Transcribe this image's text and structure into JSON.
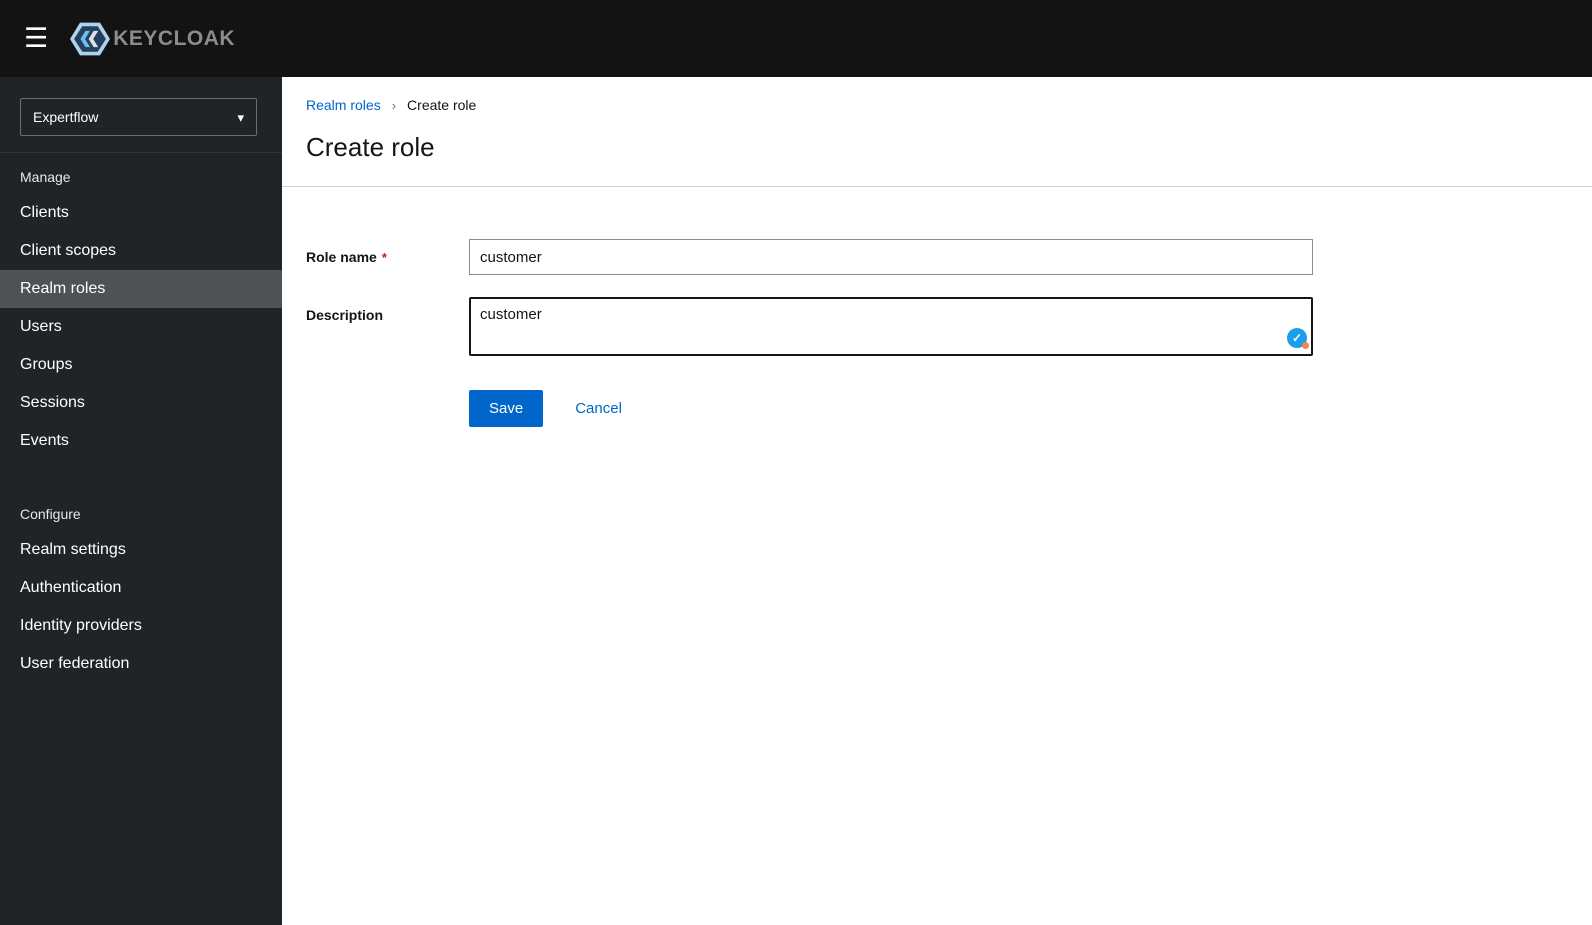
{
  "header": {
    "brand": "KEYCLOAK"
  },
  "icons": {
    "hamburger": "☰",
    "caret_down": "▾",
    "check": "✓"
  },
  "sidebar": {
    "realm_selector": {
      "value": "Expertflow"
    },
    "sections": [
      {
        "label": "Manage",
        "items": [
          {
            "label": "Clients"
          },
          {
            "label": "Client scopes"
          },
          {
            "label": "Realm roles",
            "active": true
          },
          {
            "label": "Users"
          },
          {
            "label": "Groups"
          },
          {
            "label": "Sessions"
          },
          {
            "label": "Events"
          }
        ]
      },
      {
        "label": "Configure",
        "items": [
          {
            "label": "Realm settings"
          },
          {
            "label": "Authentication"
          },
          {
            "label": "Identity providers"
          },
          {
            "label": "User federation"
          }
        ]
      }
    ]
  },
  "breadcrumb": {
    "separator": "›",
    "items": [
      {
        "label": "Realm roles"
      },
      {
        "label": "Create role"
      }
    ]
  },
  "page": {
    "title": "Create role"
  },
  "form": {
    "role_name": {
      "label": "Role name",
      "required_marker": "*",
      "value": "customer"
    },
    "description": {
      "label": "Description",
      "value": "customer"
    },
    "actions": {
      "save_label": "Save",
      "cancel_label": "Cancel"
    }
  },
  "colors": {
    "header_bg": "#131313",
    "sidebar_bg": "#212427",
    "active_nav_bg": "#4f5255",
    "accent_blue": "#0066cc",
    "required_red": "#c9190b"
  }
}
